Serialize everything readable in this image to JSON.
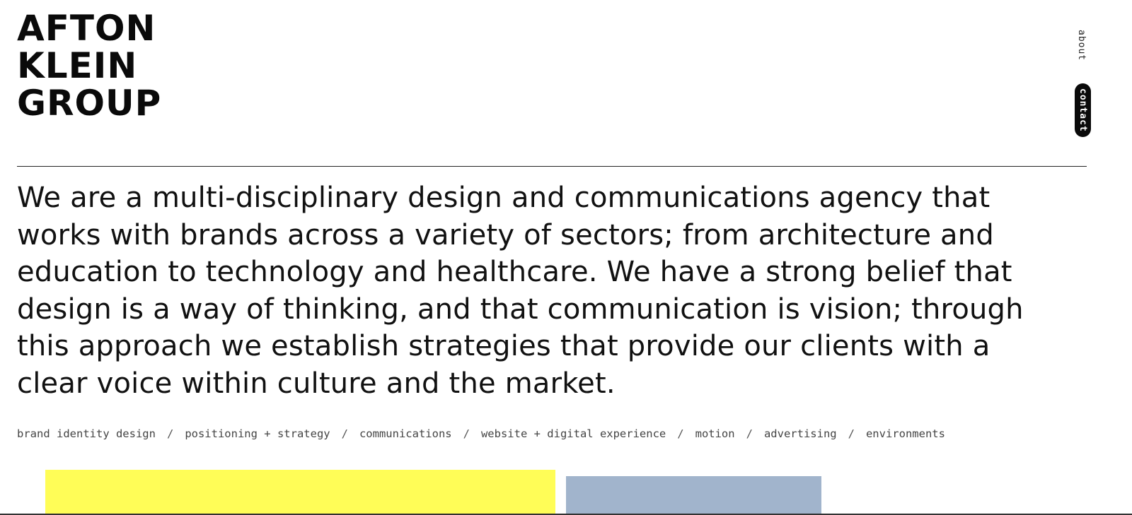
{
  "brand": {
    "lines": [
      "AFTON",
      "KLEIN",
      "GROUP"
    ]
  },
  "nav": {
    "about": "about",
    "contact": "contact"
  },
  "intro": {
    "lines": [
      "We are a multi-disciplinary design and communications agency that",
      "works with brands across a variety of sectors; from architecture and",
      "education to technology and healthcare. We have a strong belief that",
      "design is a way of thinking, and that communication is vision; through",
      "this approach we establish strategies that provide our clients with a",
      "clear voice within culture and the market."
    ]
  },
  "services": {
    "separator": "/",
    "items": [
      "brand identity design",
      "positioning + strategy",
      "communications",
      "website + digital experience",
      "motion",
      "advertising",
      "environments"
    ]
  },
  "colors": {
    "tile_yellow": "#fffd57",
    "tile_blue": "#a1b4cc",
    "text": "#111111",
    "contact_pill": "#0a0a0a"
  }
}
